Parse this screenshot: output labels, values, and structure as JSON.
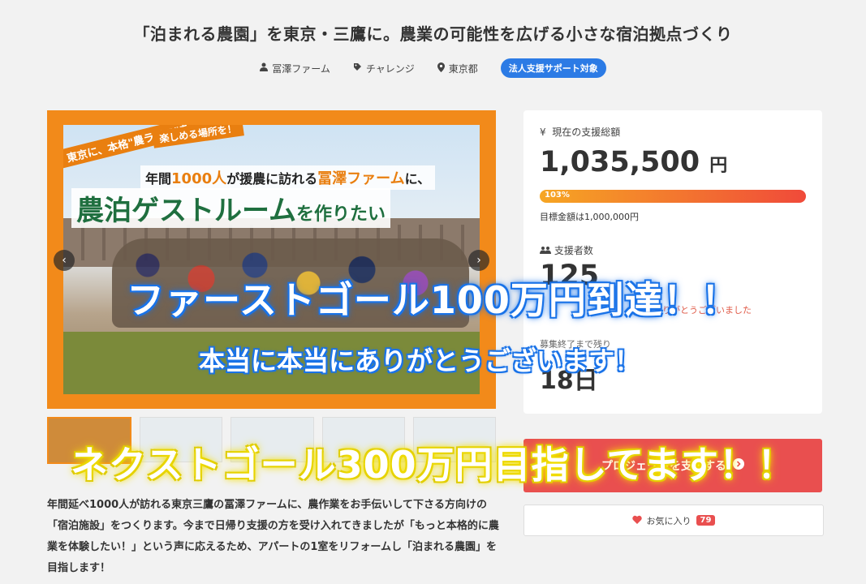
{
  "project": {
    "title": "「泊まれる農園」を東京・三鷹に。農業の可能性を広げる小さな宿泊拠点づくり",
    "owner": "冨澤ファーム",
    "category": "チャレンジ",
    "location": "東京都",
    "badge": "法人支援サポート対象"
  },
  "hero": {
    "ribbon": "東京に、本格\"農ライフ\"を",
    "ribbon2": "楽しめる場所を！",
    "sub_prefix": "年間",
    "sub_num": "1000人",
    "sub_mid": "が援農に訪れる",
    "sub_farm": "冨澤ファーム",
    "sub_suffix": "に、",
    "headline": "農泊ゲストルーム",
    "headline_suffix": "を作りたい",
    "prev": "‹",
    "next": "›"
  },
  "stats": {
    "raised_label": "現在の支援総額",
    "raised": "1,035,500",
    "currency": "円",
    "progress_pct": 103,
    "progress_label": "103%",
    "goal": "目標金額は1,000,000円",
    "backers_label": "支援者数",
    "backers": "125",
    "thanks": "ありがとうございました",
    "end_label": "募集終了まで残り",
    "days": "18日"
  },
  "support_button": "プロジェクトを支援する",
  "favorite": {
    "label": "お気に入り",
    "count": "79"
  },
  "description": "年間延べ1000人が訪れる東京三鷹の冨澤ファームに、農作業をお手伝いして下さる方向けの「宿泊施設」をつくります。今まで日帰り支援の方を受け入れてきましたが「もっと本格的に農業を体験したい！」という声に応えるため、アパートの1室をリフォームし「泊まれる農園」を目指します！",
  "overlay": {
    "line1": "ファーストゴール100万円到達！！",
    "line2": "本当に本当にありがとうございます！",
    "line3": "ネクストゴール300万円目指してます！！"
  },
  "colors": {
    "accent": "#f28a1a",
    "brand_blue": "#2c7be5",
    "red": "#e94f4f"
  }
}
